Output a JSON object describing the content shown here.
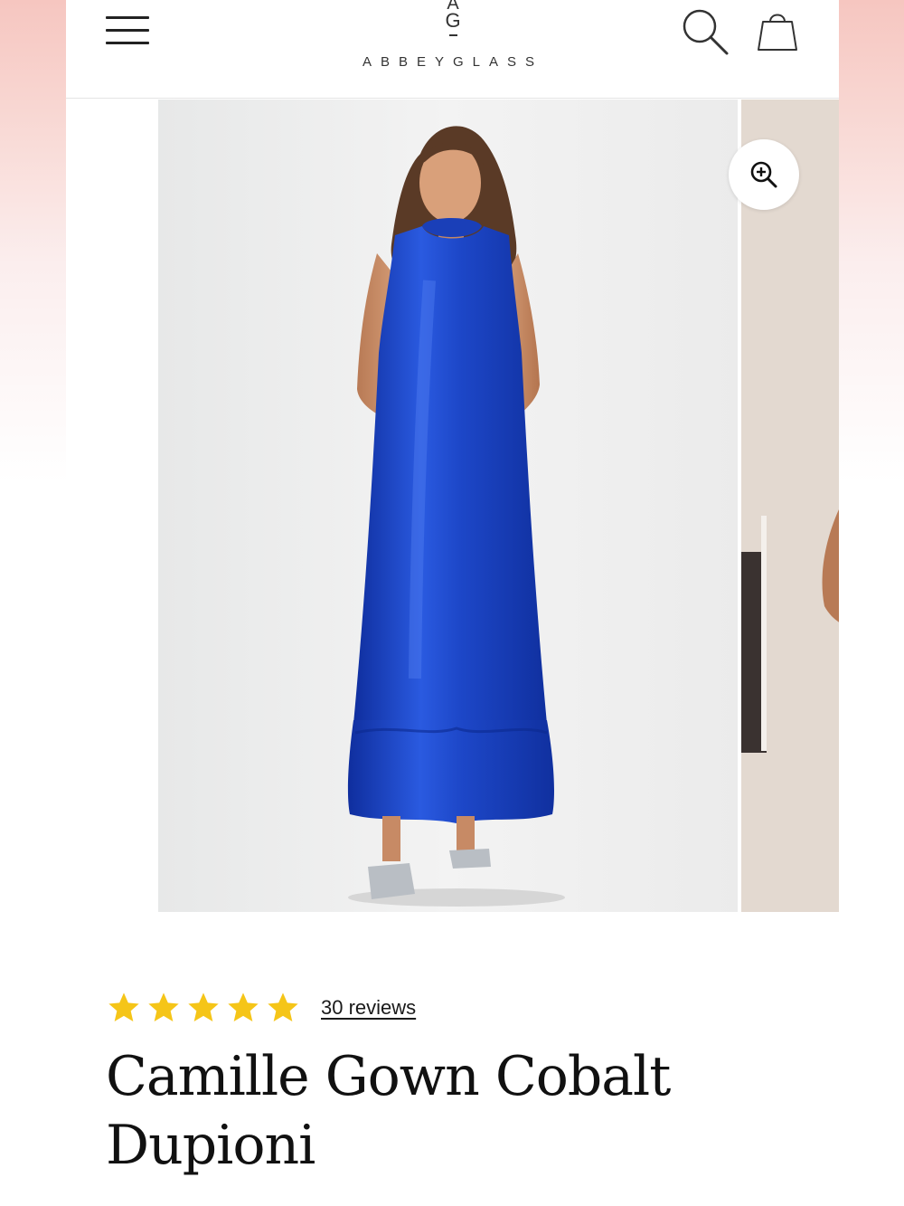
{
  "brand": {
    "monogram_top": "A",
    "monogram_bottom": "G",
    "name": "ABBEYGLASS"
  },
  "header": {
    "icons": [
      "menu-icon",
      "search-icon",
      "shopping-bag-icon"
    ]
  },
  "gallery": {
    "zoom_icon": "zoom-in-icon",
    "dress_color": "#1f46c4"
  },
  "product": {
    "rating": 5,
    "rating_max": 5,
    "star_color": "#f5c518",
    "reviews_label": "30 reviews",
    "title": "Camille Gown Cobalt Dupioni"
  }
}
